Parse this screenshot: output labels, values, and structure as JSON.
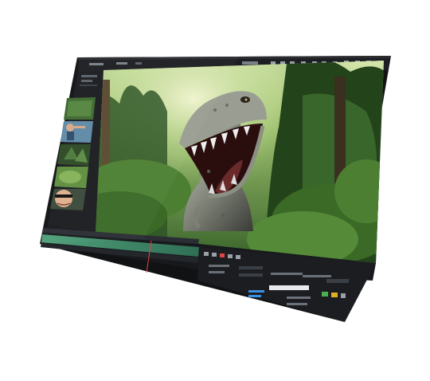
{
  "app": {
    "menu_items": [
      "",
      "",
      ""
    ],
    "toolbar_right_label": ""
  },
  "viewport": {
    "subject": "dinosaur-in-jungle"
  },
  "thumbnails": [
    {
      "name": "jungle-clip"
    },
    {
      "name": "man-pointing-clip"
    },
    {
      "name": "forest-clip"
    },
    {
      "name": "foliage-clip"
    },
    {
      "name": "man-sunglasses-clip"
    }
  ],
  "colors": {
    "bezel": "#141414",
    "panel": "#1b1d21",
    "panel_light": "#262a30",
    "accent_blue": "#3d8fe0",
    "timeline_green": "#3c8d6a",
    "jungle_dark": "#1f3a1a",
    "jungle_light": "#8fb86a"
  }
}
